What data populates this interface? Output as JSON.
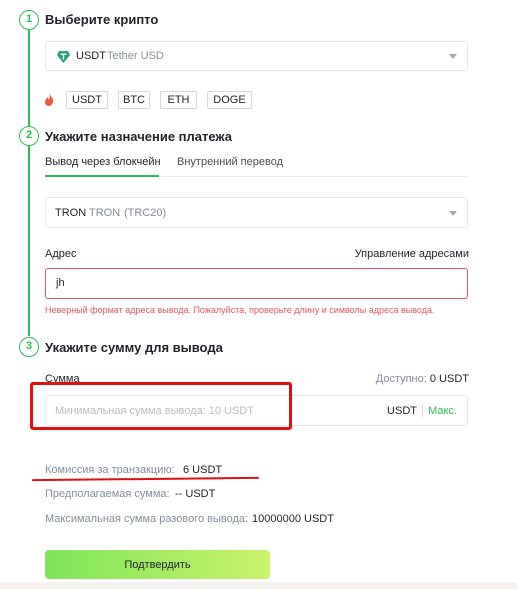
{
  "steps": {
    "step1": {
      "number": "1",
      "title": "Выберите крипто"
    },
    "step2": {
      "number": "2",
      "title": "Укажите назначение платежа"
    },
    "step3": {
      "number": "3",
      "title": "Укажите сумму для вывода"
    }
  },
  "crypto_select": {
    "symbol": "USDT",
    "name": "Tether USD",
    "icon": "tether-icon"
  },
  "quick_coins": {
    "icon": "fire-icon",
    "items": [
      "USDT",
      "BTC",
      "ETH",
      "DOGE"
    ]
  },
  "tabs": {
    "blockchain": "Вывод через блокчейн",
    "internal": "Внутренний перевод",
    "active": "blockchain"
  },
  "network_select": {
    "symbol": "TRON",
    "name": "TRON",
    "standard": "(TRC20)"
  },
  "address": {
    "label": "Адрес",
    "manage_link": "Управление адресами",
    "value": "jh",
    "error": "Неверный формат адреса вывода. Пожалуйста, проверьте длину и символы адреса вывода."
  },
  "amount": {
    "label": "Сумма",
    "available_label": "Доступно:",
    "available_value": "0 USDT",
    "placeholder": "Минимальная сумма вывода: 10 USDT",
    "unit": "USDT",
    "max_label": "Макс."
  },
  "summary": {
    "fee_label": "Комиссия за транзакцию:",
    "fee_value": "6 USDT",
    "expected_label": "Предполагаемая сумма:",
    "expected_value": "-- USDT",
    "max_single_label": "Максимальная сумма разового вывода:",
    "max_single_value": "10000000 USDT"
  },
  "confirm_button": "Подтвердить",
  "colors": {
    "accent": "#2ebd52",
    "error": "#e05a60",
    "annotation": "#e01010",
    "usdt": "#26a17b"
  }
}
